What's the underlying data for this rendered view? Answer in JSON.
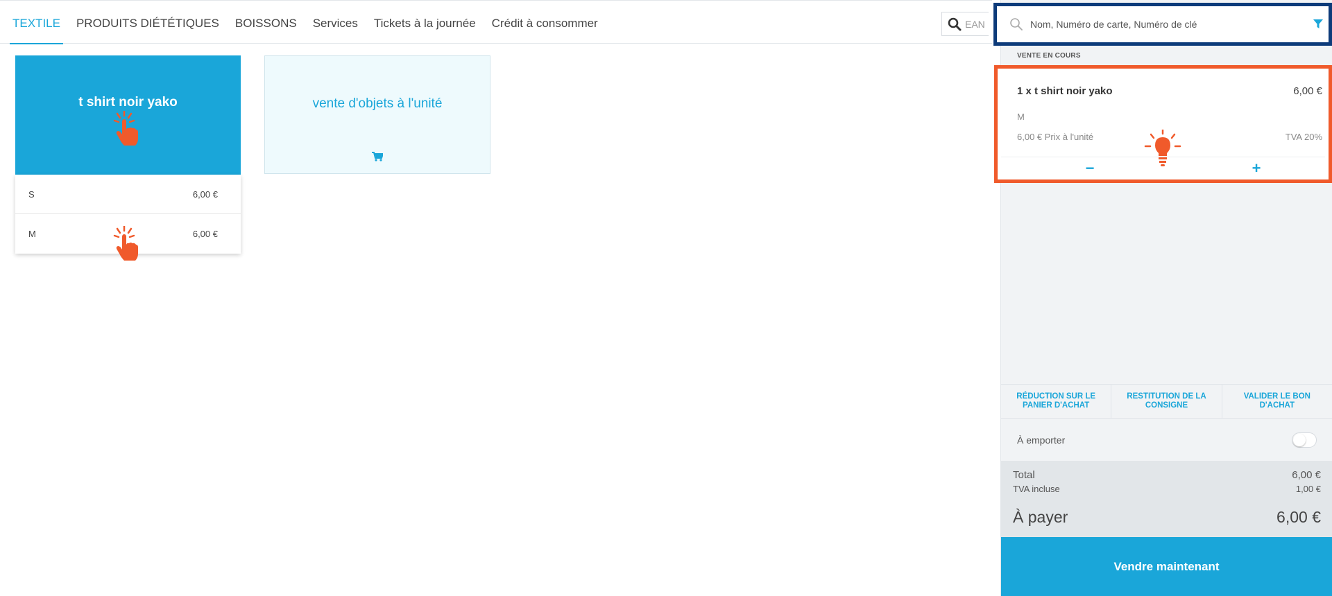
{
  "nav": {
    "tabs": [
      {
        "label": "TEXTILE",
        "active": true
      },
      {
        "label": "PRODUITS DIÉTÉTIQUES"
      },
      {
        "label": "BOISSONS"
      },
      {
        "label": "Services"
      },
      {
        "label": "Tickets à la journée"
      },
      {
        "label": "Crédit à consommer"
      }
    ],
    "ean_placeholder": "EAN"
  },
  "products": {
    "tile1": {
      "name": "t shirt noir yako",
      "icon": "grid-icon",
      "variants": [
        {
          "label": "S",
          "price": "6,00 €"
        },
        {
          "label": "M",
          "price": "6,00 €"
        }
      ]
    },
    "tile2": {
      "name": "vente d'objets à l'unité",
      "icon": "cart-icon"
    }
  },
  "panel": {
    "search_placeholder": "Nom, Numéro de carte, Numéro de clé",
    "section_label": "VENTE EN COURS",
    "cart_item": {
      "title": "1 x t shirt noir yako",
      "price": "6,00 €",
      "variant": "M",
      "unit_price": "6,00 € Prix à l'unité",
      "tva": "TVA 20%",
      "minus": "−",
      "plus": "+"
    },
    "actions": [
      "RÉDUCTION SUR LE PANIER D'ACHAT",
      "RESTITUTION DE LA CONSIGNE",
      "VALIDER LE BON D'ACHAT"
    ],
    "takeaway_label": "À emporter",
    "totals": {
      "total_label": "Total",
      "total_value": "6,00 €",
      "tva_label": "TVA incluse",
      "tva_value": "1,00 €",
      "pay_label": "À payer",
      "pay_value": "6,00 €"
    },
    "sell_button": "Vendre maintenant"
  },
  "colors": {
    "accent": "#1aa6d9",
    "highlight_orange": "#f05a2b",
    "highlight_navy": "#0d3b7a"
  }
}
